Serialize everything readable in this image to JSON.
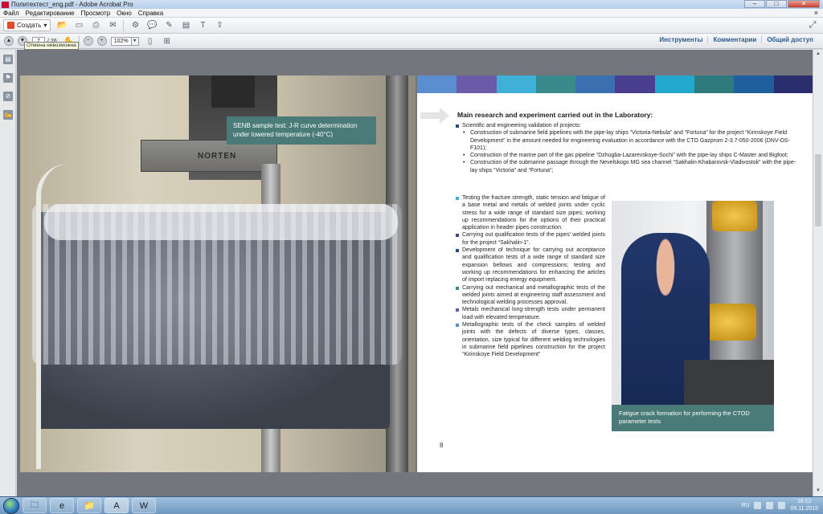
{
  "window": {
    "title": "Политехтест_eng.pdf - Adobe Acrobat Pro",
    "controls": {
      "minimize": "–",
      "maximize": "□",
      "close": "✕"
    }
  },
  "menu": {
    "items": [
      "Файл",
      "Редактирование",
      "Просмотр",
      "Окно",
      "Справка"
    ],
    "close_label": "×"
  },
  "toolbar": {
    "create_label": "Создать",
    "icons": [
      "open-icon",
      "save-icon",
      "print-icon",
      "email-icon",
      "gear-icon",
      "comment-icon",
      "stamp-icon",
      "highlight-icon",
      "text-edit-icon",
      "share-icon"
    ]
  },
  "navigation": {
    "current_page": "7",
    "total_pages": "/ 26",
    "zoom": "102%",
    "tooltip": "Отмена невозможна"
  },
  "right_tabs": [
    "Инструменты",
    "Комментарии",
    "Общий доступ"
  ],
  "document": {
    "left_caption": "SENB sample test:  J-R curve determination under lowered temperature (-40°C)",
    "nameplate": "NORTEN",
    "heading": "Main research and experiment carried out in the Laboratory:",
    "para1": "Scientific and engineering validation of projects:",
    "sub1": "Construction of submarine field pipelines with the pipe-lay ships “Victoria-Nebula” and “Fortuna” for the project “Kirinskoye Field Development” in the amount needed for engineering evaluation in accordance with the CTO Gazprom 2-3.7-050-2006 (DNV-OS-F101);",
    "sub2": "Construction of the marine part of the gas pipeline “Dzhugba-Lazarevskoye-Sochi” with the pipe-lay ships C-Master and Bigfoot;",
    "sub3": "Construction of the submarine passage through the Nevelskogo MG sea channel “Sakhalin-Khabarovsk-Vladivostok” with the pipe-lay ships “Victoria” and “Fortuna”;",
    "para2": "Testing the fracture strength, static tension and fatigue of a base metal and metals of welded joints under cyclic stress for a wide range of standard size pipes; working up recommendations for the options of their practical application in header pipes construction.",
    "para3": "Carrying out qualification tests of the pipes’ welded joints for the project “Sakhalin-1”.",
    "para4": "Development of technique for carrying out acceptance and qualification tests of a wide range of standard size expansion bellows and compressions; testing and working up recommendations for enhancing the articles of import replacing energy equipment.",
    "para5": "Carrying out mechanical and metallographic tests of the welded joints aimed at engineering staff assessment and technological welding processes approval.",
    "para6": "Metals mechanical long-strength tests under permanent load with elevated temperature.",
    "para7": "Metallographic tests of the check samples of welded joints with the defects of diverse types, classes, orientation, size typical for different welding technologies in submarine field pipelines construction for the project “Kirinskoye Field Development”",
    "right_caption": "Fatigue crack formation for performing the CTOD parameter tests",
    "page_number": "8"
  },
  "colors": {
    "stripes": [
      "#5b8ed0",
      "#6a5aa8",
      "#3fb0d8",
      "#3a8a8c",
      "#3a6fb0",
      "#4a3f8e",
      "#23a9cf",
      "#2e7a7c",
      "#1f5f9e",
      "#2a2d6e"
    ],
    "bullets": [
      "#1f4f7a",
      "#3fb0d8",
      "#4a3f8e",
      "#1f4f7a",
      "#3a8a8c",
      "#6a5aa8",
      "#5b8ed0"
    ],
    "caption_bg": "#4a7b78"
  },
  "taskbar": {
    "apps": [
      "explorer-icon",
      "ie-icon",
      "folder-icon",
      "acrobat-icon",
      "word-icon"
    ],
    "language": "RU",
    "time": "16:12",
    "date": "09.11.2015"
  }
}
